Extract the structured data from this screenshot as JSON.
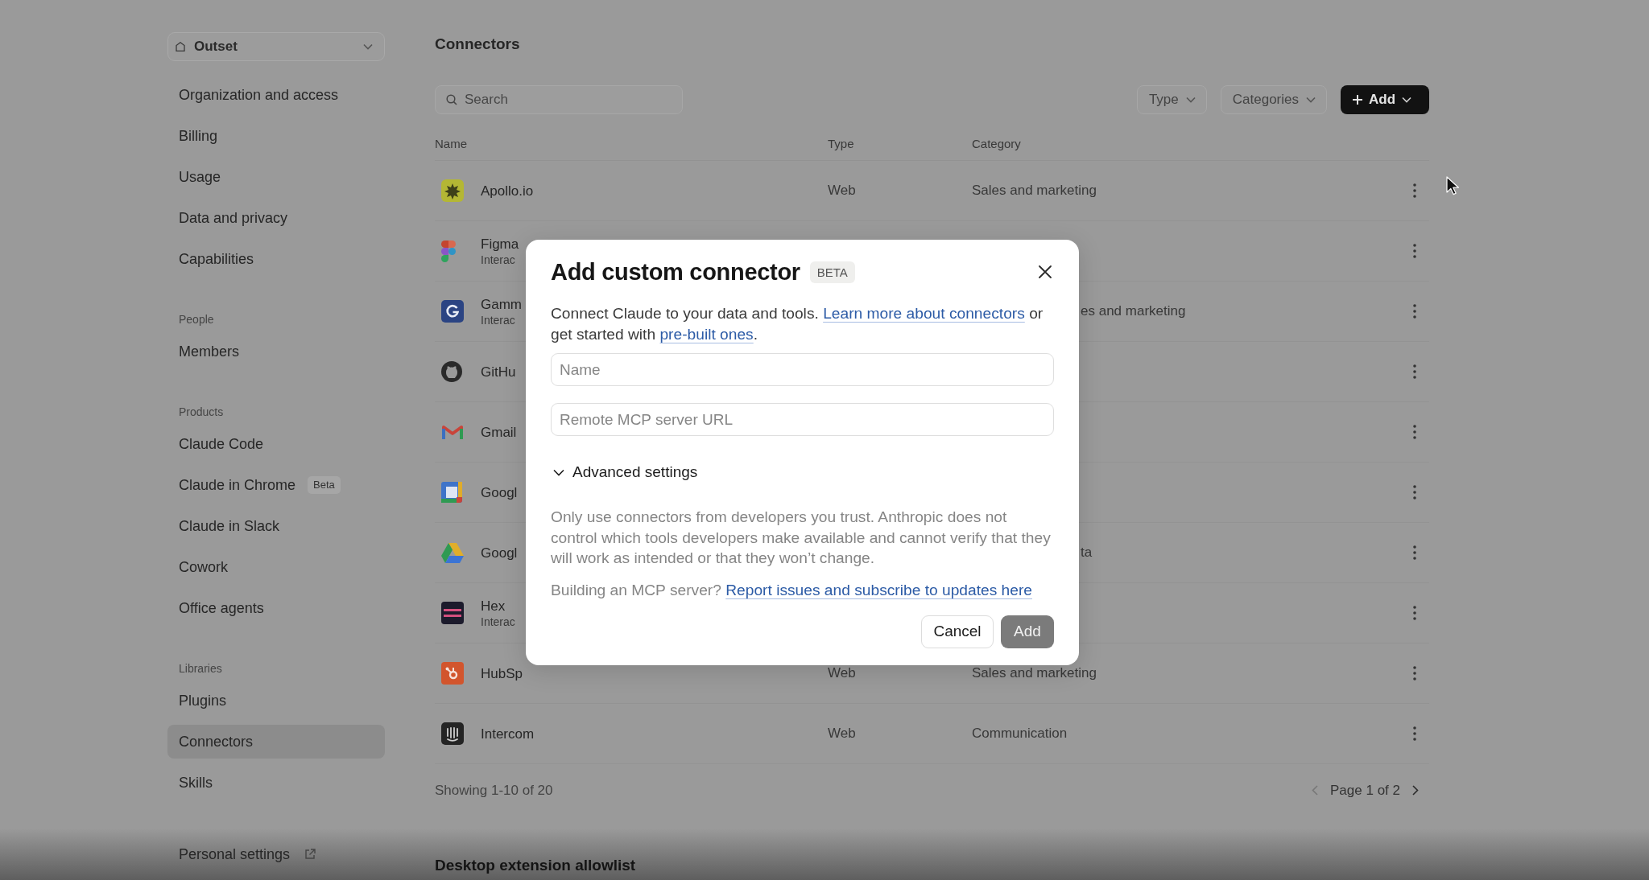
{
  "workspace": {
    "label": "Outset"
  },
  "sidebar": {
    "sections": [
      {
        "items": [
          {
            "label": "Organization and access",
            "selected": false
          },
          {
            "label": "Billing",
            "selected": false
          },
          {
            "label": "Usage",
            "selected": false
          },
          {
            "label": "Data and privacy",
            "selected": false
          },
          {
            "label": "Capabilities",
            "selected": false
          }
        ]
      },
      {
        "heading": "People",
        "items": [
          {
            "label": "Members",
            "selected": false
          }
        ]
      },
      {
        "heading": "Products",
        "items": [
          {
            "label": "Claude Code",
            "selected": false
          },
          {
            "label": "Claude in Chrome",
            "selected": false,
            "badge": "Beta"
          },
          {
            "label": "Claude in Slack",
            "selected": false
          },
          {
            "label": "Cowork",
            "selected": false
          },
          {
            "label": "Office agents",
            "selected": false
          }
        ]
      },
      {
        "heading": "Libraries",
        "items": [
          {
            "label": "Plugins",
            "selected": false
          },
          {
            "label": "Connectors",
            "selected": true
          },
          {
            "label": "Skills",
            "selected": false
          }
        ]
      }
    ],
    "footer_link": {
      "label": "Personal settings"
    }
  },
  "page": {
    "title": "Connectors",
    "search": {
      "placeholder": "Search"
    },
    "filters": [
      {
        "label": "Type"
      },
      {
        "label": "Categories"
      }
    ],
    "add_button": {
      "label": "Add"
    },
    "table": {
      "columns": [
        "Name",
        "Type",
        "Category"
      ],
      "rows": [
        {
          "kind": "burst",
          "name": "Apollo.io",
          "type": "Web",
          "category": "Sales and marketing"
        },
        {
          "kind": "shapes",
          "name": "Figma",
          "subtitle": "Interac"
        },
        {
          "kind": "letter",
          "name": "Gamm",
          "subtitle": "Interac",
          "category": "es and marketing"
        },
        {
          "kind": "cat",
          "name": "GitHu"
        },
        {
          "kind": "mail",
          "name": "Gmail"
        },
        {
          "kind": "calendar",
          "name": "Googl"
        },
        {
          "kind": "triangle",
          "name": "Googl",
          "category": "ta"
        },
        {
          "kind": "stripes",
          "name": "Hex",
          "subtitle": "Interac"
        },
        {
          "kind": "sprocket",
          "name": "HubSp",
          "type": "Web",
          "category": "Sales and marketing"
        },
        {
          "kind": "grid",
          "name": "Intercom",
          "type": "Web",
          "category": "Communication"
        }
      ]
    },
    "footer": {
      "summary": "Showing 1-10 of 20",
      "pagination": {
        "label": "Page 1 of 2",
        "has_previous": false,
        "has_next": true
      }
    },
    "next_section": {
      "title": "Desktop extension allowlist"
    }
  },
  "modal": {
    "title": "Add custom connector",
    "badge": "BETA",
    "intro": [
      {
        "kind": "text",
        "text": "Connect Claude to your data and tools. "
      },
      {
        "kind": "link",
        "text": "Learn more about connectors"
      },
      {
        "kind": "text",
        "text": " or get started with "
      },
      {
        "kind": "link",
        "text": "pre-built ones"
      },
      {
        "kind": "text",
        "text": "."
      }
    ],
    "fields": [
      {
        "placeholder": "Name"
      },
      {
        "placeholder": "Remote MCP server URL"
      }
    ],
    "advanced": {
      "label": "Advanced settings",
      "expanded": false
    },
    "warning": "Only use connectors from developers you trust. Anthropic does not control which tools developers make available and cannot verify that they will work as intended or that they won’t change.",
    "help": [
      {
        "kind": "text",
        "text": "Building an MCP server? "
      },
      {
        "kind": "link",
        "text": "Report issues and subscribe to updates here"
      }
    ],
    "buttons": [
      {
        "label": "Cancel",
        "kind": "secondary",
        "disabled": false
      },
      {
        "label": "Add",
        "kind": "primary",
        "disabled": true
      }
    ]
  }
}
